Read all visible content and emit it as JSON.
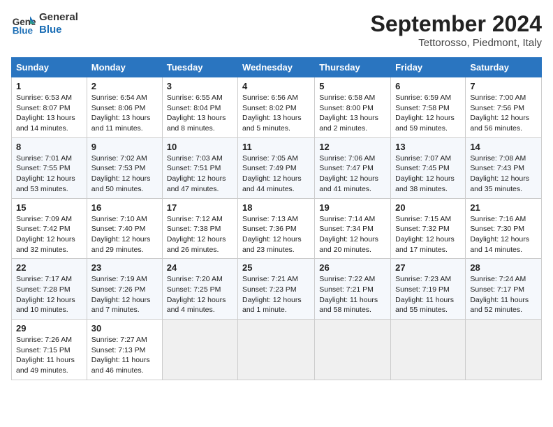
{
  "header": {
    "logo_general": "General",
    "logo_blue": "Blue",
    "month_year": "September 2024",
    "location": "Tettorosso, Piedmont, Italy"
  },
  "weekdays": [
    "Sunday",
    "Monday",
    "Tuesday",
    "Wednesday",
    "Thursday",
    "Friday",
    "Saturday"
  ],
  "weeks": [
    [
      {
        "day": "1",
        "sunrise": "6:53 AM",
        "sunset": "8:07 PM",
        "daylight": "13 hours and 14 minutes."
      },
      {
        "day": "2",
        "sunrise": "6:54 AM",
        "sunset": "8:06 PM",
        "daylight": "13 hours and 11 minutes."
      },
      {
        "day": "3",
        "sunrise": "6:55 AM",
        "sunset": "8:04 PM",
        "daylight": "13 hours and 8 minutes."
      },
      {
        "day": "4",
        "sunrise": "6:56 AM",
        "sunset": "8:02 PM",
        "daylight": "13 hours and 5 minutes."
      },
      {
        "day": "5",
        "sunrise": "6:58 AM",
        "sunset": "8:00 PM",
        "daylight": "13 hours and 2 minutes."
      },
      {
        "day": "6",
        "sunrise": "6:59 AM",
        "sunset": "7:58 PM",
        "daylight": "12 hours and 59 minutes."
      },
      {
        "day": "7",
        "sunrise": "7:00 AM",
        "sunset": "7:56 PM",
        "daylight": "12 hours and 56 minutes."
      }
    ],
    [
      {
        "day": "8",
        "sunrise": "7:01 AM",
        "sunset": "7:55 PM",
        "daylight": "12 hours and 53 minutes."
      },
      {
        "day": "9",
        "sunrise": "7:02 AM",
        "sunset": "7:53 PM",
        "daylight": "12 hours and 50 minutes."
      },
      {
        "day": "10",
        "sunrise": "7:03 AM",
        "sunset": "7:51 PM",
        "daylight": "12 hours and 47 minutes."
      },
      {
        "day": "11",
        "sunrise": "7:05 AM",
        "sunset": "7:49 PM",
        "daylight": "12 hours and 44 minutes."
      },
      {
        "day": "12",
        "sunrise": "7:06 AM",
        "sunset": "7:47 PM",
        "daylight": "12 hours and 41 minutes."
      },
      {
        "day": "13",
        "sunrise": "7:07 AM",
        "sunset": "7:45 PM",
        "daylight": "12 hours and 38 minutes."
      },
      {
        "day": "14",
        "sunrise": "7:08 AM",
        "sunset": "7:43 PM",
        "daylight": "12 hours and 35 minutes."
      }
    ],
    [
      {
        "day": "15",
        "sunrise": "7:09 AM",
        "sunset": "7:42 PM",
        "daylight": "12 hours and 32 minutes."
      },
      {
        "day": "16",
        "sunrise": "7:10 AM",
        "sunset": "7:40 PM",
        "daylight": "12 hours and 29 minutes."
      },
      {
        "day": "17",
        "sunrise": "7:12 AM",
        "sunset": "7:38 PM",
        "daylight": "12 hours and 26 minutes."
      },
      {
        "day": "18",
        "sunrise": "7:13 AM",
        "sunset": "7:36 PM",
        "daylight": "12 hours and 23 minutes."
      },
      {
        "day": "19",
        "sunrise": "7:14 AM",
        "sunset": "7:34 PM",
        "daylight": "12 hours and 20 minutes."
      },
      {
        "day": "20",
        "sunrise": "7:15 AM",
        "sunset": "7:32 PM",
        "daylight": "12 hours and 17 minutes."
      },
      {
        "day": "21",
        "sunrise": "7:16 AM",
        "sunset": "7:30 PM",
        "daylight": "12 hours and 14 minutes."
      }
    ],
    [
      {
        "day": "22",
        "sunrise": "7:17 AM",
        "sunset": "7:28 PM",
        "daylight": "12 hours and 10 minutes."
      },
      {
        "day": "23",
        "sunrise": "7:19 AM",
        "sunset": "7:26 PM",
        "daylight": "12 hours and 7 minutes."
      },
      {
        "day": "24",
        "sunrise": "7:20 AM",
        "sunset": "7:25 PM",
        "daylight": "12 hours and 4 minutes."
      },
      {
        "day": "25",
        "sunrise": "7:21 AM",
        "sunset": "7:23 PM",
        "daylight": "12 hours and 1 minute."
      },
      {
        "day": "26",
        "sunrise": "7:22 AM",
        "sunset": "7:21 PM",
        "daylight": "11 hours and 58 minutes."
      },
      {
        "day": "27",
        "sunrise": "7:23 AM",
        "sunset": "7:19 PM",
        "daylight": "11 hours and 55 minutes."
      },
      {
        "day": "28",
        "sunrise": "7:24 AM",
        "sunset": "7:17 PM",
        "daylight": "11 hours and 52 minutes."
      }
    ],
    [
      {
        "day": "29",
        "sunrise": "7:26 AM",
        "sunset": "7:15 PM",
        "daylight": "11 hours and 49 minutes."
      },
      {
        "day": "30",
        "sunrise": "7:27 AM",
        "sunset": "7:13 PM",
        "daylight": "11 hours and 46 minutes."
      },
      null,
      null,
      null,
      null,
      null
    ]
  ]
}
